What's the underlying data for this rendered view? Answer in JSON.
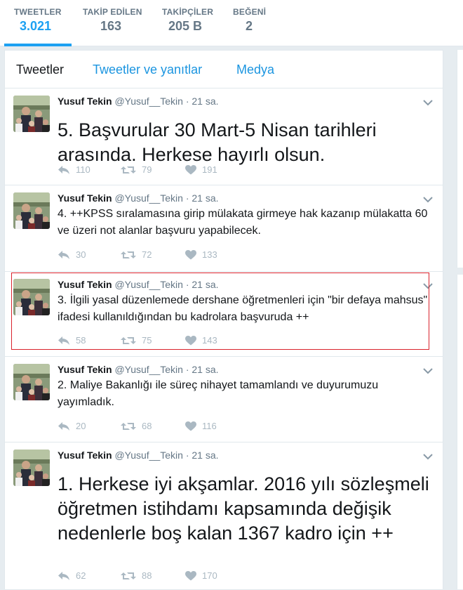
{
  "stats": [
    {
      "label": "TWEETLER",
      "value": "3.021",
      "active": true
    },
    {
      "label": "TAKİP EDİLEN",
      "value": "163",
      "active": false
    },
    {
      "label": "TAKİPÇİLER",
      "value": "205 B",
      "active": false
    },
    {
      "label": "BEĞENİ",
      "value": "2",
      "active": false
    }
  ],
  "tabs": {
    "tweets": "Tweetler",
    "replies": "Tweetler ve yanıtlar",
    "media": "Medya"
  },
  "colors": {
    "accent": "#1da1f2",
    "highlight_border": "#d9232d"
  },
  "tweets": [
    {
      "name": "Yusuf Tekin",
      "handle": "@Yusuf__Tekin",
      "time": "· 21 sa.",
      "text": "5. Başvurular 30 Mart-5 Nisan tarihleri arasında. Herkese hayırlı olsun.",
      "replies": "110",
      "retweets": "79",
      "likes": "191"
    },
    {
      "name": "Yusuf Tekin",
      "handle": "@Yusuf__Tekin",
      "time": "· 21 sa.",
      "text": "4. ++KPSS sıralamasına girip mülakata girmeye hak kazanıp mülakatta 60 ve üzeri not alanlar başvuru yapabilecek.",
      "replies": "30",
      "retweets": "72",
      "likes": "133"
    },
    {
      "name": "Yusuf Tekin",
      "handle": "@Yusuf__Tekin",
      "time": "· 21 sa.",
      "text": "3. İlgili yasal düzenlemede dershane öğretmenleri için \"bir defaya mahsus\" ifadesi kullanıldığından bu kadrolara başvuruda ++",
      "replies": "58",
      "retweets": "75",
      "likes": "143"
    },
    {
      "name": "Yusuf Tekin",
      "handle": "@Yusuf__Tekin",
      "time": "· 21 sa.",
      "text": "2. Maliye Bakanlığı ile süreç nihayet tamamlandı ve duyurumuzu yayımladık.",
      "replies": "20",
      "retweets": "68",
      "likes": "116"
    },
    {
      "name": "Yusuf Tekin",
      "handle": "@Yusuf__Tekin",
      "time": "· 21 sa.",
      "text": "1. Herkese iyi akşamlar. 2016 yılı sözleşmeli öğretmen istihdamı kapsamında değişik nedenlerle boş kalan 1367 kadro için ++",
      "replies": "62",
      "retweets": "88",
      "likes": "170"
    }
  ],
  "icons": {
    "reply": "reply-icon",
    "retweet": "retweet-icon",
    "like": "heart-icon",
    "more": "chevron-down-icon"
  }
}
